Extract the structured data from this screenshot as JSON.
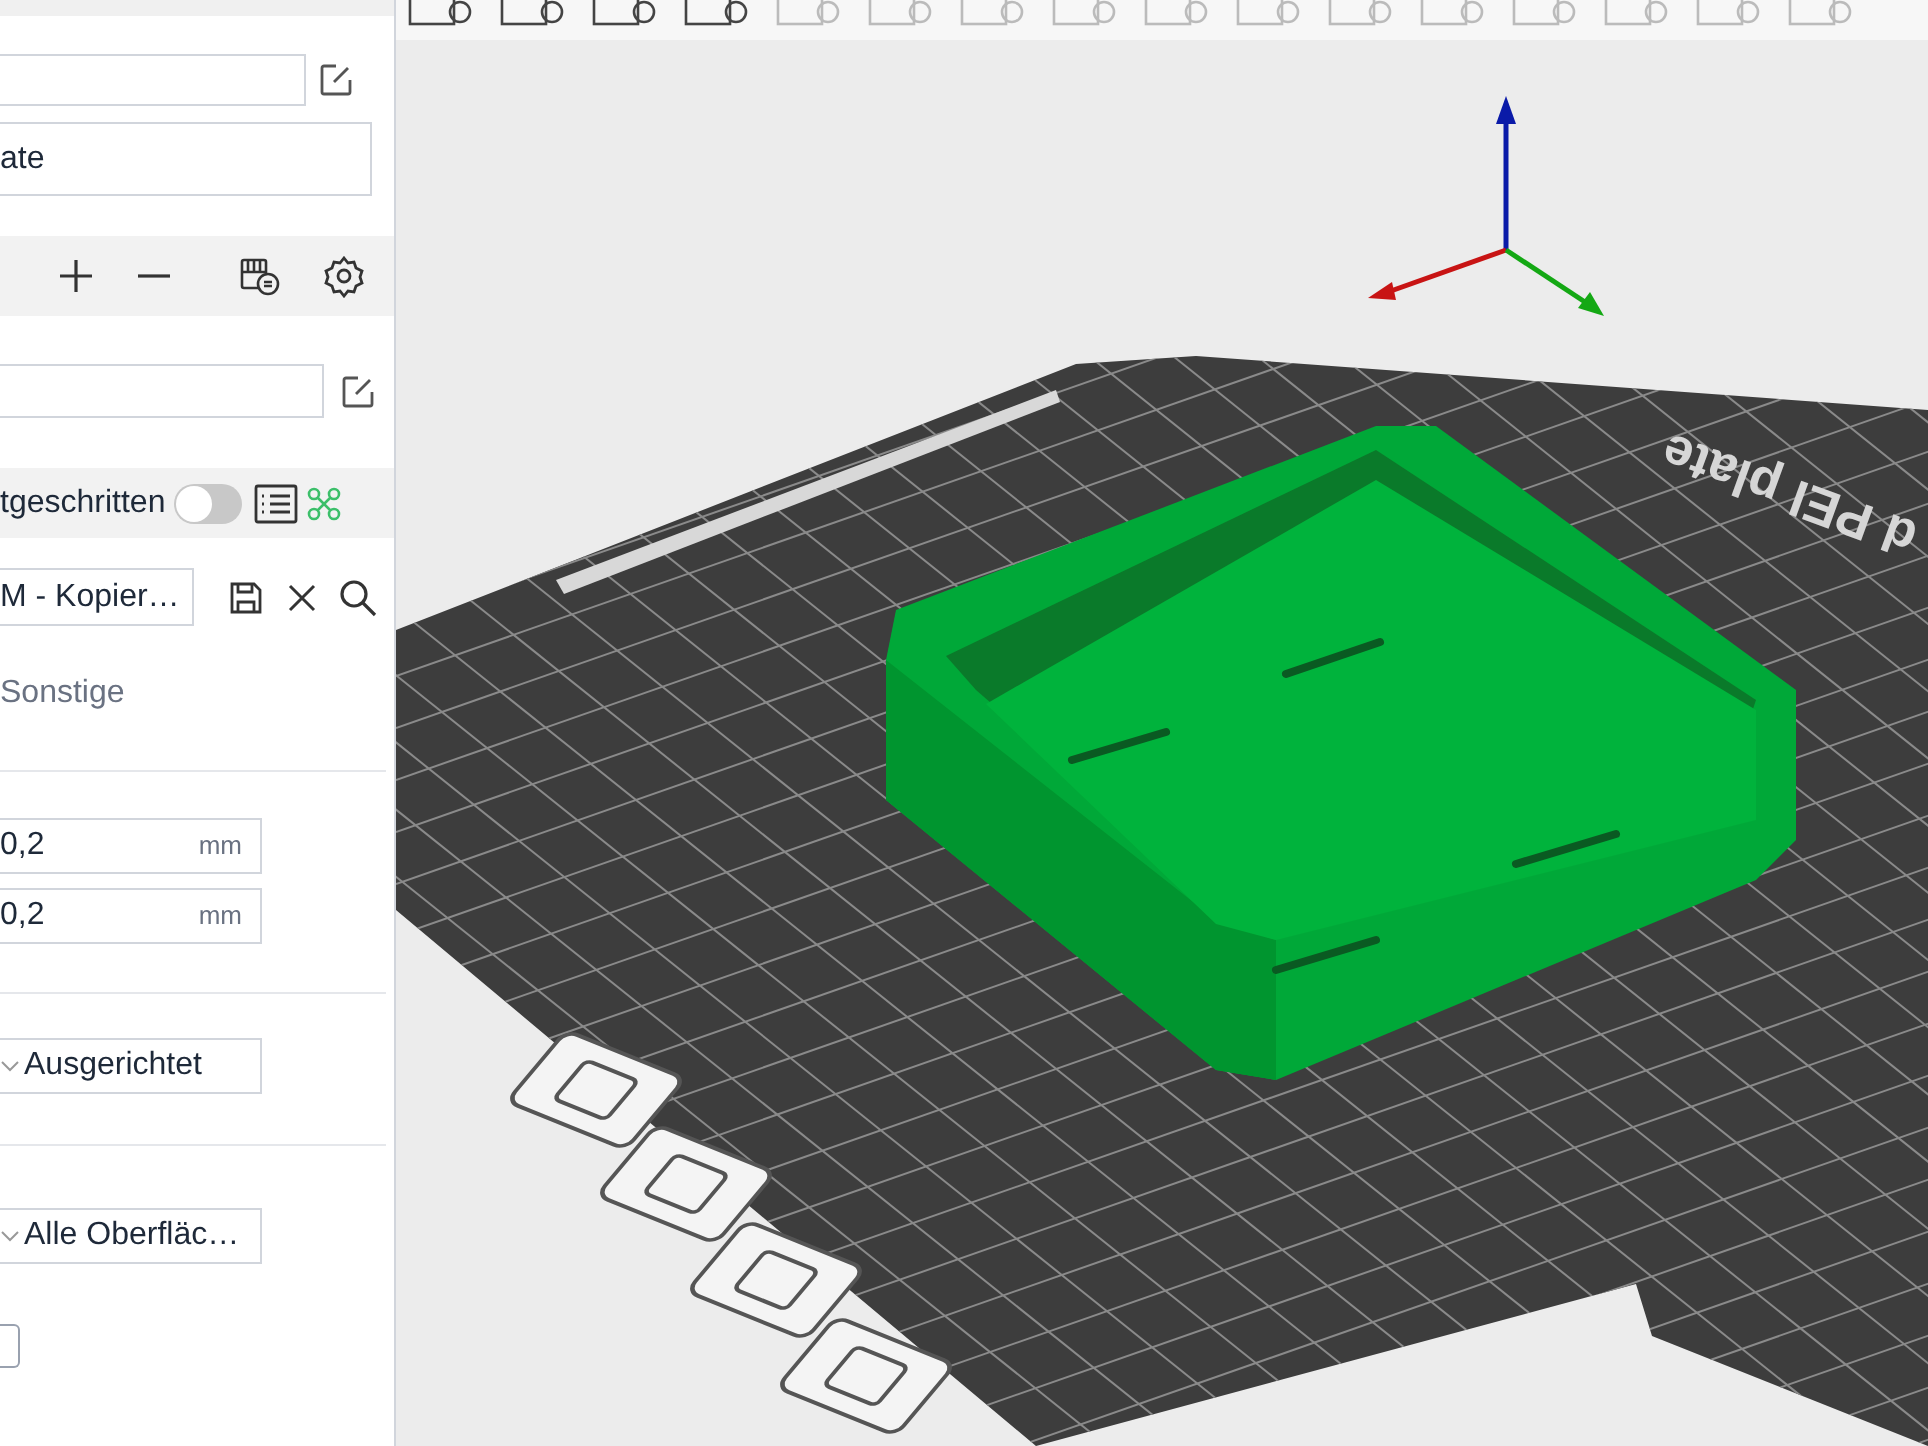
{
  "sidebar": {
    "plate_field": {
      "value": "ate"
    },
    "process_header": {
      "label": "tgeschritten",
      "advanced_on": false
    },
    "preset_dropdown": {
      "value": "M - Kopier…"
    },
    "tab_label": "Sonstige",
    "numeric_fields": [
      {
        "value": "0,2",
        "unit": "mm"
      },
      {
        "value": "0,2",
        "unit": "mm"
      }
    ],
    "dropdowns": [
      {
        "value": "Ausgerichtet"
      },
      {
        "value": "Alle Oberfläc…"
      }
    ],
    "checkbox": {
      "checked": false
    }
  },
  "viewport": {
    "bed_label": "d PEI plate"
  }
}
